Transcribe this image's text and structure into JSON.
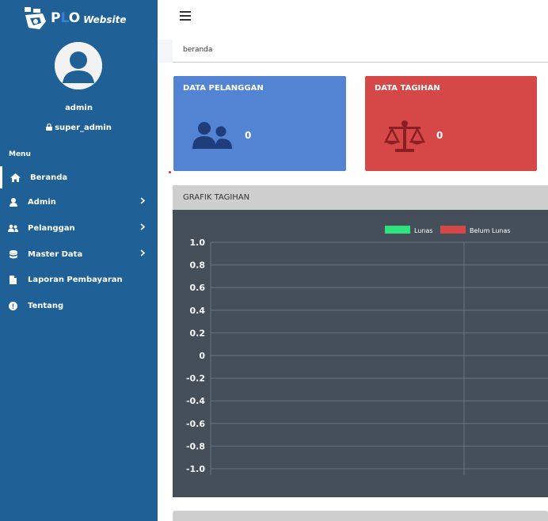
{
  "brand": {
    "title_p": "P",
    "title_l": "L",
    "title_o": "O",
    "subtitle": "Website"
  },
  "user": {
    "name": "admin",
    "role": "super_admin"
  },
  "sidebar": {
    "menu_header": "Menu",
    "items": [
      {
        "label": "Beranda",
        "icon": "home-icon",
        "active": true
      },
      {
        "label": "Admin",
        "icon": "user-icon",
        "chevron": true
      },
      {
        "label": "Pelanggan",
        "icon": "users-icon",
        "chevron": true
      },
      {
        "label": "Master Data",
        "icon": "database-icon",
        "chevron": true
      },
      {
        "label": "Laporan Pembayaran",
        "icon": "file-icon"
      },
      {
        "label": "Tentang",
        "icon": "info-icon"
      }
    ]
  },
  "breadcrumb": "beranda",
  "cards": [
    {
      "title": "DATA PELANGGAN",
      "value": "0",
      "color": "#5383d3",
      "icon": "users-icon"
    },
    {
      "title": "DATA TAGIHAN",
      "value": "0",
      "color": "#d64747",
      "icon": "balance-scale-icon"
    }
  ],
  "chart": {
    "title": "GRAFIK TAGIHAN"
  },
  "chart_data": {
    "type": "bar",
    "categories": [],
    "series": [
      {
        "name": "Lunas",
        "color": "#2ee57d",
        "values": []
      },
      {
        "name": "Belum Lunas",
        "color": "#d64747",
        "values": []
      }
    ],
    "ylim": [
      -1.0,
      1.0
    ],
    "yticks": [
      "1.0",
      "0.8",
      "0.6",
      "0.4",
      "0.2",
      "0",
      "-0.2",
      "-0.4",
      "-0.6",
      "-0.8",
      "-1.0"
    ],
    "legend": "top",
    "grid": true
  }
}
